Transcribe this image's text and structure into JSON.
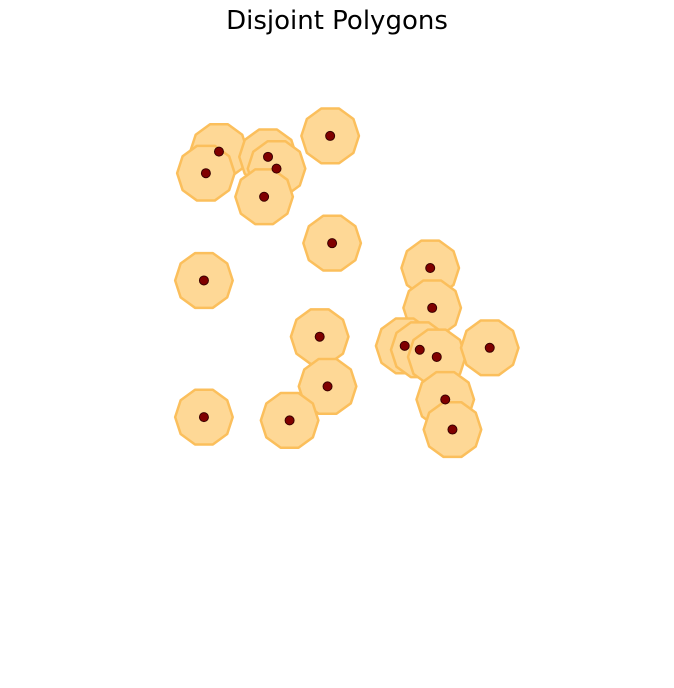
{
  "chart_data": {
    "type": "scatter",
    "title": "Disjoint Polygons",
    "axes_visible": false,
    "polygon_sides": 10,
    "polygon_radius": 4.4,
    "xlim": [
      0,
      100
    ],
    "ylim": [
      0,
      100
    ],
    "colors": {
      "polygon_fill": "#fed896",
      "polygon_edge": "#fbbf5c",
      "overlap_edge": "#fbb230",
      "point_fill": "#800000",
      "point_edge": "#3a0000"
    },
    "points": [
      {
        "x": 31.8,
        "y": 78.5
      },
      {
        "x": 29.8,
        "y": 75.2
      },
      {
        "x": 39.3,
        "y": 77.7
      },
      {
        "x": 40.6,
        "y": 75.9
      },
      {
        "x": 48.8,
        "y": 80.9
      },
      {
        "x": 38.7,
        "y": 71.6
      },
      {
        "x": 49.1,
        "y": 64.5
      },
      {
        "x": 29.5,
        "y": 58.8
      },
      {
        "x": 64.1,
        "y": 60.7
      },
      {
        "x": 64.4,
        "y": 54.6
      },
      {
        "x": 47.2,
        "y": 50.2
      },
      {
        "x": 60.2,
        "y": 48.8
      },
      {
        "x": 62.5,
        "y": 48.2
      },
      {
        "x": 65.1,
        "y": 47.1
      },
      {
        "x": 73.2,
        "y": 48.5
      },
      {
        "x": 48.4,
        "y": 42.6
      },
      {
        "x": 66.4,
        "y": 40.6
      },
      {
        "x": 29.5,
        "y": 37.9
      },
      {
        "x": 42.6,
        "y": 37.4
      },
      {
        "x": 67.5,
        "y": 36.0
      }
    ]
  }
}
